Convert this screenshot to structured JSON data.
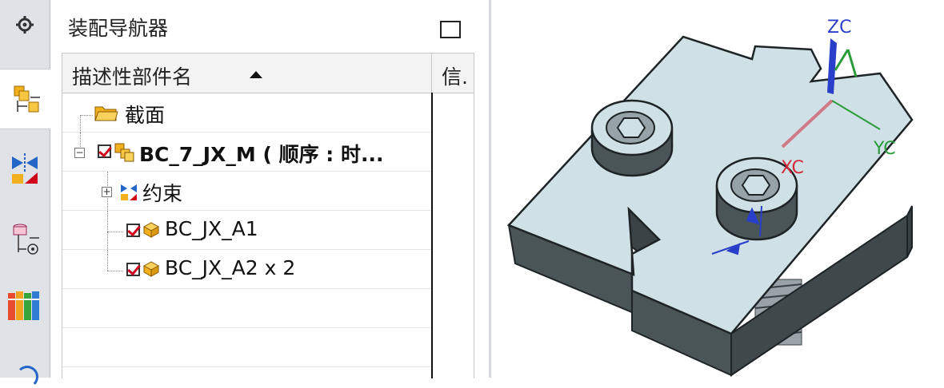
{
  "panel": {
    "title": "装配导航器",
    "column_name": "描述性部件名",
    "column_info": "信."
  },
  "tree": {
    "items": [
      {
        "label": "截面",
        "icon": "folder-icon"
      },
      {
        "label": "BC_7_JX_M ( 顺序 : 时...",
        "icon": "assembly-icon",
        "checked": true,
        "expanded": true
      },
      {
        "label": "约束",
        "icon": "constraints-icon",
        "collapsed": true
      },
      {
        "label": "BC_JX_A1",
        "icon": "component-icon",
        "checked": true
      },
      {
        "label": "BC_JX_A2 x 2",
        "icon": "component-icon",
        "checked": true
      }
    ]
  },
  "rail": {
    "tabs": [
      "settings-icon",
      "assembly-navigator-icon",
      "constraint-navigator-icon",
      "part-navigator-icon",
      "reuse-library-icon"
    ]
  },
  "viewport": {
    "axes": {
      "zc": "ZC",
      "yc": "YC",
      "xc": "XC"
    },
    "colors": {
      "zc": "#2a3fc9",
      "yc": "#2a9c3a",
      "xc": "#d2283a",
      "model": "#cfe0e6"
    }
  }
}
